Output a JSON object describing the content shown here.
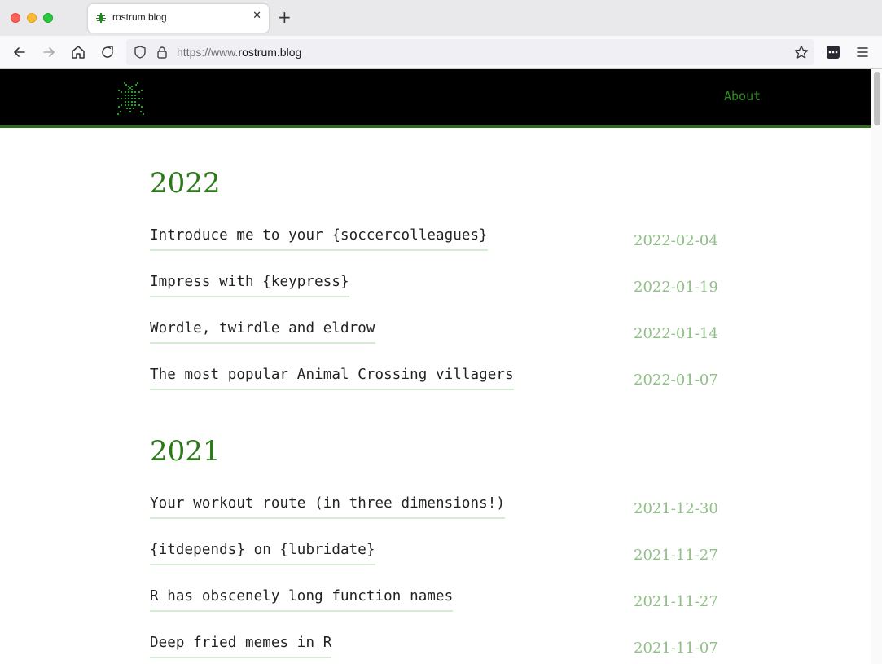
{
  "browser": {
    "tab_title": "rostrum.blog",
    "tab_close": "✕",
    "new_tab": "+",
    "url_prefix": "https://www.",
    "url_domain": "rostrum.blog"
  },
  "site": {
    "about_label": "About",
    "accent_color": "#2a7a18",
    "date_color": "#8fc085"
  },
  "sections": [
    {
      "year": "2022",
      "posts": [
        {
          "title": "Introduce me to your {soccercolleagues}",
          "date": "2022-02-04"
        },
        {
          "title": "Impress with {keypress}",
          "date": "2022-01-19"
        },
        {
          "title": "Wordle, twirdle and eldrow",
          "date": "2022-01-14"
        },
        {
          "title": "The most popular Animal Crossing villagers",
          "date": "2022-01-07"
        }
      ]
    },
    {
      "year": "2021",
      "posts": [
        {
          "title": "Your workout route (in three dimensions!)",
          "date": "2021-12-30"
        },
        {
          "title": "{itdepends} on {lubridate}",
          "date": "2021-11-27"
        },
        {
          "title": "R has obscenely long function names",
          "date": "2021-11-27"
        },
        {
          "title": "Deep fried memes in R",
          "date": "2021-11-07"
        }
      ]
    }
  ]
}
